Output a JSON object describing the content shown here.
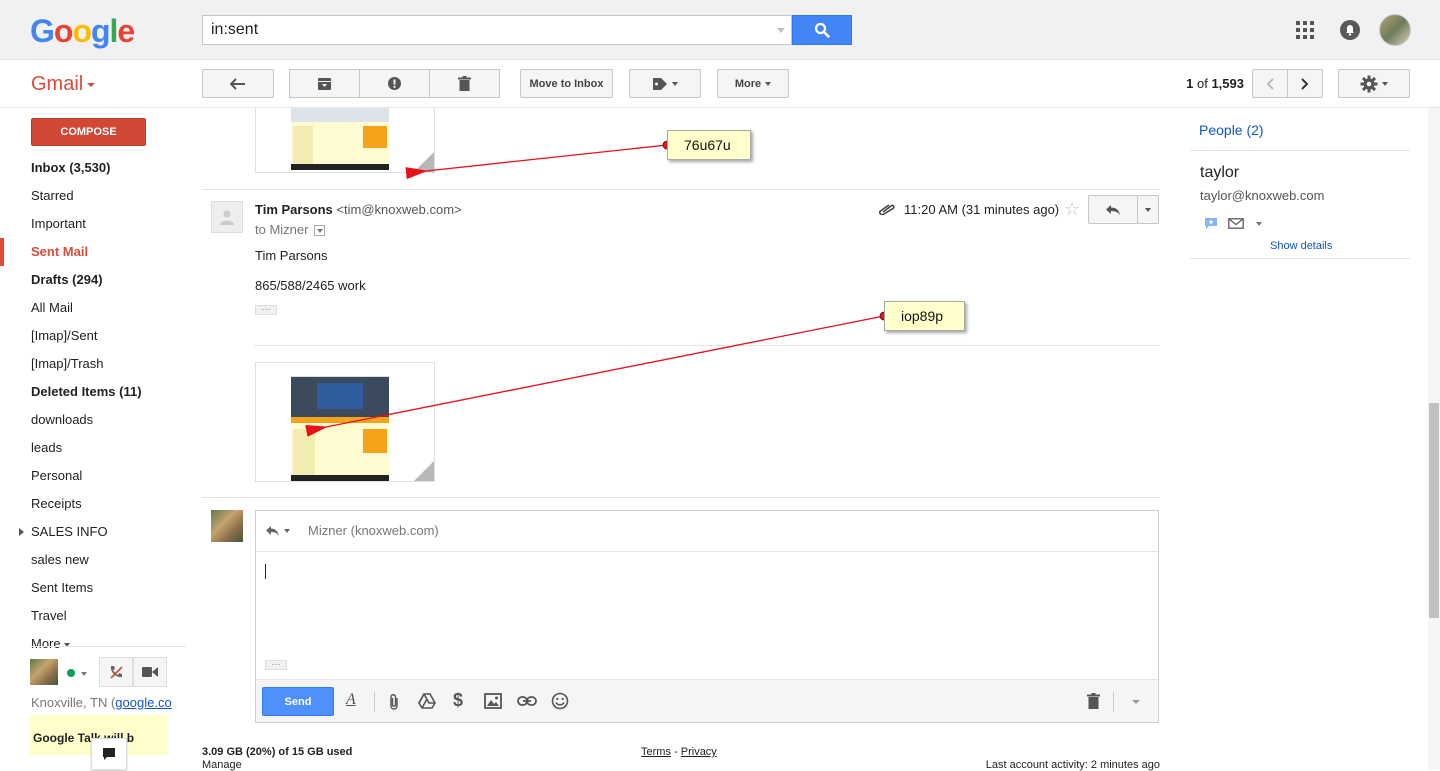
{
  "header": {
    "logo_letters": [
      {
        "ch": "G",
        "color": "#4285f4"
      },
      {
        "ch": "o",
        "color": "#ea4335"
      },
      {
        "ch": "o",
        "color": "#fbbc05"
      },
      {
        "ch": "g",
        "color": "#4285f4"
      },
      {
        "ch": "l",
        "color": "#34a853"
      },
      {
        "ch": "e",
        "color": "#ea4335"
      }
    ],
    "search_value": "in:sent",
    "icons": [
      "search-icon",
      "apps-icon",
      "notifications-icon",
      "account-avatar"
    ]
  },
  "toolbar": {
    "app_label": "Gmail",
    "move_to_inbox": "Move to Inbox",
    "more": "More",
    "pager_start": "1",
    "pager_of": "of",
    "pager_total": "1,593"
  },
  "sidebar": {
    "compose": "COMPOSE",
    "items": [
      {
        "label": "Inbox (3,530)",
        "bold": true
      },
      {
        "label": "Starred"
      },
      {
        "label": "Important"
      },
      {
        "label": "Sent Mail",
        "active": true
      },
      {
        "label": "Drafts (294)",
        "bold": true
      },
      {
        "label": "All Mail"
      },
      {
        "label": "[Imap]/Sent"
      },
      {
        "label": "[Imap]/Trash"
      },
      {
        "label": "Deleted Items (11)",
        "bold": true
      },
      {
        "label": "downloads"
      },
      {
        "label": "leads"
      },
      {
        "label": "Personal"
      },
      {
        "label": "Receipts"
      },
      {
        "label": "SALES INFO",
        "expandable": true
      },
      {
        "label": "sales new"
      },
      {
        "label": "Sent Items"
      },
      {
        "label": "Travel"
      },
      {
        "label": "More"
      }
    ],
    "location": "Knoxville, TN (",
    "location_link": "google.co",
    "talk_notice": "Google Talk will b"
  },
  "message": {
    "sender_name": "Tim Parsons",
    "sender_email": "<tim@knoxweb.com>",
    "to": "to Mizner",
    "time": "11:20 AM (31 minutes ago)",
    "body_line1": "Tim Parsons",
    "body_line2": "865/588/2465 work",
    "ellipsis": "···"
  },
  "annotations": {
    "note1": "76u67u",
    "note2": "iop89p",
    "color": "#e8101a"
  },
  "reply": {
    "recipient": "Mizner (knoxweb.com)",
    "ellipsis": "···",
    "send": "Send"
  },
  "footer": {
    "storage": "3.09 GB (20%) of 15 GB used",
    "manage": "Manage",
    "terms": "Terms",
    "dash": "-",
    "privacy": "Privacy",
    "activity": "Last account activity: 2 minutes ago"
  },
  "people": {
    "title": "People (2)",
    "name": "taylor",
    "email": "taylor@knoxweb.com",
    "show_details": "Show details"
  },
  "colors": {
    "accent_red": "#dd4b39",
    "search_blue": "#4285f4",
    "send_blue": "#4d90fe",
    "link_blue": "#1155cc"
  }
}
